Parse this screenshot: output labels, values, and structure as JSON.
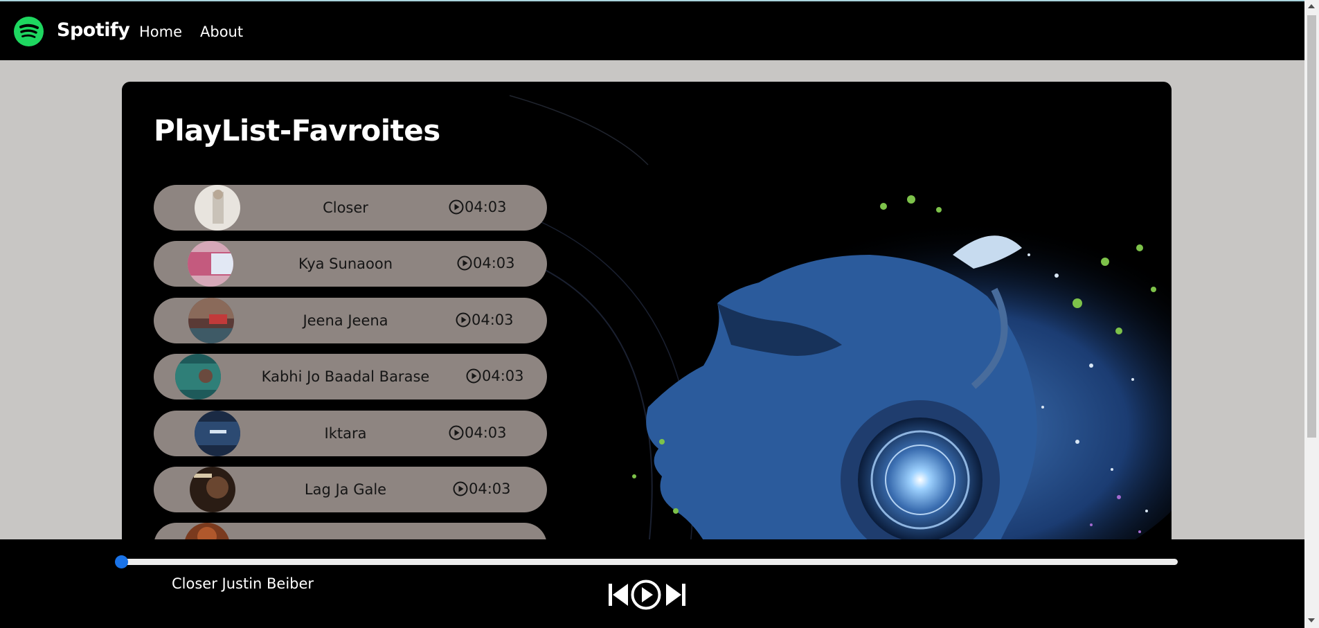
{
  "nav": {
    "brand": "Spotify",
    "links": [
      "Home",
      "About"
    ]
  },
  "main": {
    "title": "PlayList-Favroites",
    "songs": [
      {
        "name": "Closer",
        "duration": "04:03"
      },
      {
        "name": "Kya Sunaoon",
        "duration": "04:03"
      },
      {
        "name": "Jeena Jeena",
        "duration": "04:03"
      },
      {
        "name": "Kabhi Jo Baadal Barase",
        "duration": "04:03"
      },
      {
        "name": "Iktara",
        "duration": "04:03"
      },
      {
        "name": "Lag Ja Gale",
        "duration": "04:03"
      }
    ]
  },
  "player": {
    "now_playing": "Closer Justin Beiber",
    "progress": 0,
    "controls": [
      "previous-icon",
      "play-icon",
      "next-icon"
    ]
  },
  "colors": {
    "accent": "#1ed760",
    "song_pill": "#8e8581",
    "background": "#c8c6c4",
    "bars": "#000000",
    "progress_thumb": "#1a73e8"
  }
}
